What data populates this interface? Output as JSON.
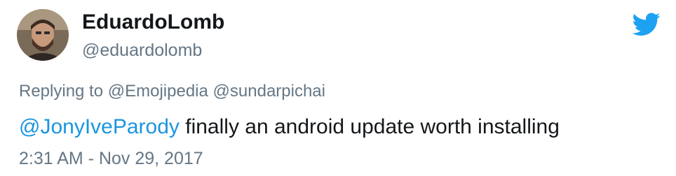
{
  "author": {
    "display_name": "EduardoLomb",
    "handle": "@eduardolomb",
    "avatar_icon": "user-avatar"
  },
  "brand": {
    "icon": "twitter-bird-icon",
    "color": "#1da1f2"
  },
  "reply": {
    "prefix": "Replying to",
    "mentions": [
      "@Emojipedia",
      "@sundarpichai"
    ]
  },
  "tweet": {
    "mention": "@JonyIveParody",
    "text": " finally an android update worth installing",
    "timestamp": "2:31 AM - Nov 29, 2017"
  },
  "colors": {
    "link": "#1b95e0",
    "muted": "#657786",
    "text": "#14171a"
  }
}
